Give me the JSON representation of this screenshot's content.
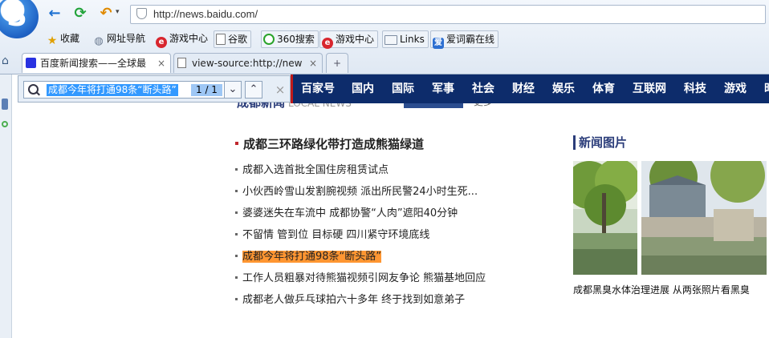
{
  "browser": {
    "url": "http://news.baidu.com/",
    "bookmarks": [
      {
        "label": "收藏",
        "icon": "star-icon"
      },
      {
        "label": "网址导航",
        "icon": "globe-icon"
      },
      {
        "label": "游戏中心",
        "icon": "game-icon"
      },
      {
        "label": "谷歌",
        "icon": "page-icon"
      },
      {
        "label": "360搜索",
        "icon": "360-icon"
      },
      {
        "label": "游戏中心",
        "icon": "game-icon"
      },
      {
        "label": "Links",
        "icon": "folder-icon"
      },
      {
        "label": "爱词霸在线",
        "icon": "iciba-icon"
      }
    ],
    "tabs": [
      {
        "label": "百度新闻搜索——全球最",
        "close": "×",
        "active": true
      },
      {
        "label": "view-source:http://new",
        "close": "×",
        "active": false
      }
    ],
    "new_tab": "+"
  },
  "findbar": {
    "query": "成都今年将打通98条“断头路”",
    "count": "1 / 1",
    "prev": "⌄",
    "next": "⌃",
    "close": "×"
  },
  "nav": {
    "items": [
      "百家号",
      "国内",
      "国际",
      "军事",
      "社会",
      "财经",
      "娱乐",
      "体育",
      "互联网",
      "科技",
      "游戏",
      "时"
    ]
  },
  "section": {
    "title": "成都新闻",
    "title_en": "LOCAL NEWS",
    "more": "更多"
  },
  "news": {
    "headline": "成都三环路绿化带打造成熊猫绿道",
    "items": [
      "成都入选首批全国住房租赁试点",
      "小伙西岭雪山发割腕视频 派出所民警24小时生死...",
      "婆婆迷失在车流中 成都协警“人肉”遮阳40分钟",
      "不留情 管到位 目标硬 四川紧守环境底线",
      "成都今年将打通98条“断头路”",
      "工作人员粗暴对待熊猫视频引网友争论 熊猫基地回应",
      "成都老人做乒乓球拍六十多年 终于找到如意弟子"
    ],
    "highlighted_index": 4
  },
  "pictures": {
    "title": "新闻图片",
    "caption": "成都黑臭水体治理进展 从两张照片看黑臭"
  },
  "colors": {
    "nav_bg": "#0d2c6b",
    "highlight": "#ff9632",
    "find_selection": "#3399ff",
    "accent_red": "#c0272d"
  }
}
